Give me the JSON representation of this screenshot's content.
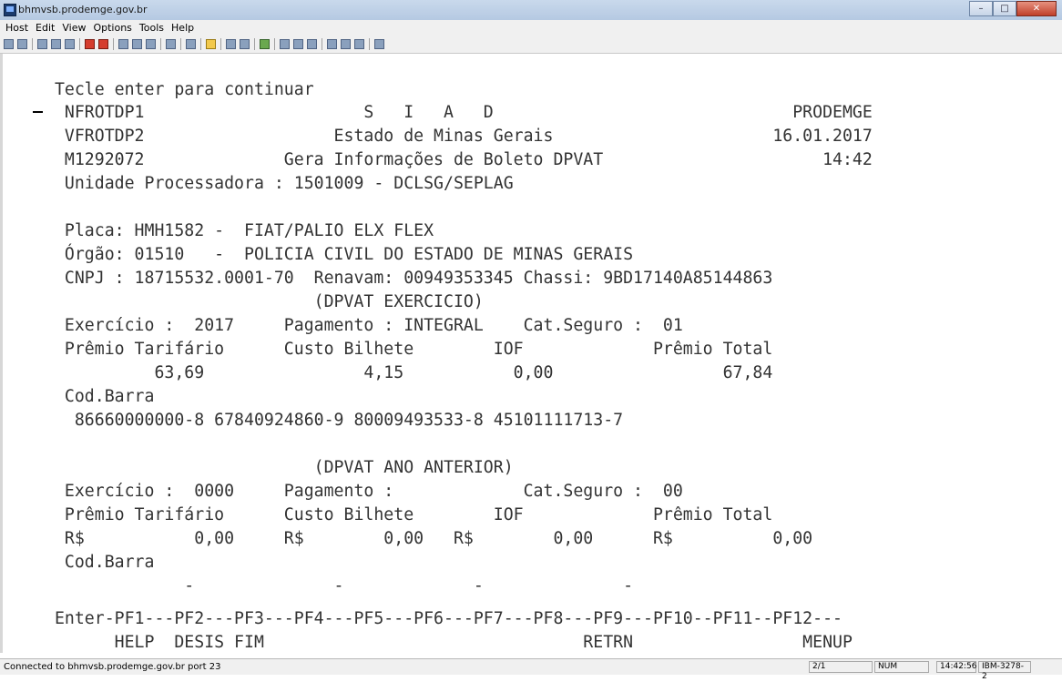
{
  "window": {
    "title": "bhmvsb.prodemge.gov.br"
  },
  "menu": [
    "Host",
    "Edit",
    "View",
    "Options",
    "Tools",
    "Help"
  ],
  "terminal": {
    "lines": [
      " Tecle enter para continuar",
      "  NFROTDP1                      S   I   A   D                              PRODEMGE",
      "  VFROTDP2                   Estado de Minas Gerais                      16.01.2017",
      "  M1292072              Gera Informações de Boleto DPVAT                      14:42",
      "  Unidade Processadora : 1501009 - DCLSG/SEPLAG",
      "",
      "  Placa: HMH1582 -  FIAT/PALIO ELX FLEX",
      "  Órgão: 01510   -  POLICIA CIVIL DO ESTADO DE MINAS GERAIS",
      "  CNPJ : 18715532.0001-70  Renavam: 00949353345 Chassi: 9BD17140A85144863",
      "                           (DPVAT EXERCICIO)",
      "  Exercício :  2017     Pagamento : INTEGRAL    Cat.Seguro :  01",
      "  Prêmio Tarifário      Custo Bilhete        IOF             Prêmio Total",
      "           63,69                4,15           0,00                 67,84",
      "  Cod.Barra",
      "   86660000000-8 67840924860-9 80009493533-8 45101111713-7",
      "",
      "                           (DPVAT ANO ANTERIOR)",
      "  Exercício :  0000     Pagamento :             Cat.Seguro :  00",
      "  Prêmio Tarifário      Custo Bilhete        IOF             Prêmio Total",
      "  R$           0,00     R$        0,00   R$        0,00      R$          0,00",
      "  Cod.Barra",
      "              -              -             -              -",
      "",
      " Enter-PF1---PF2---PF3---PF4---PF5---PF6---PF7---PF8---PF9---PF10--PF11--PF12---",
      "       HELP  DESIS FIM                                RETRN                 MENUP"
    ]
  },
  "status": {
    "connection": "Connected to bhmvsb.prodemge.gov.br port 23",
    "page": "2/1",
    "numlock": "NUM",
    "time": "14:42:56",
    "model": "IBM-3278-2"
  }
}
